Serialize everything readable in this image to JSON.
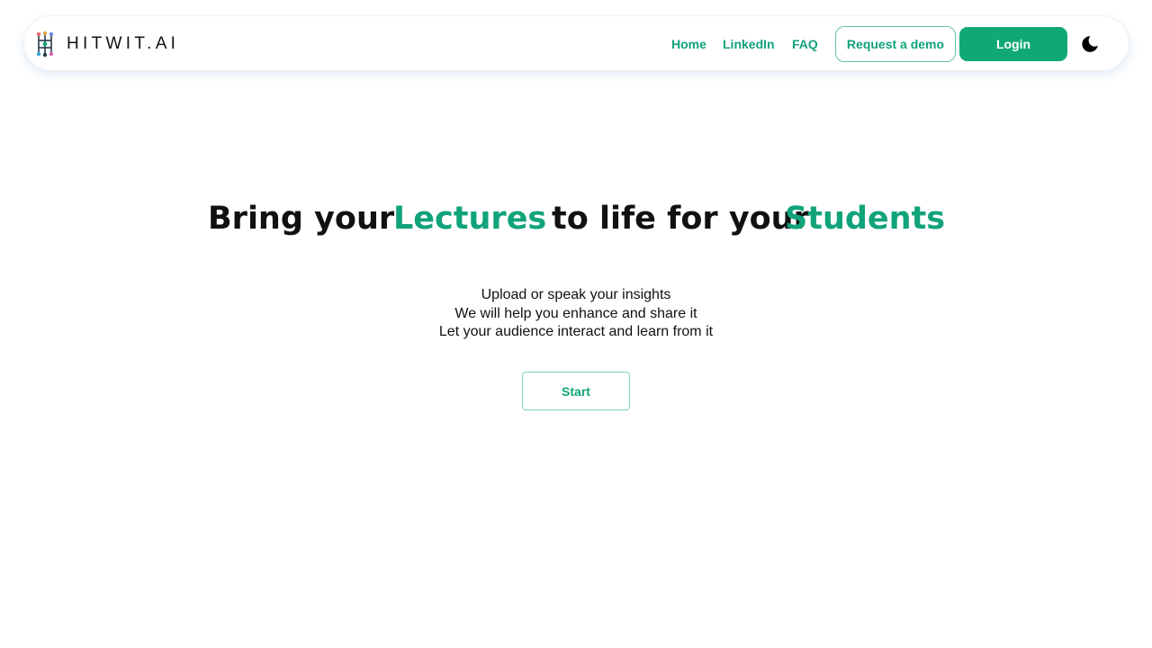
{
  "brand": {
    "name": "HITWIT.AI",
    "logo_icon": "circuit-logo-icon"
  },
  "nav": {
    "links": [
      "Home",
      "LinkedIn",
      "FAQ"
    ],
    "demo_label": "Request a demo",
    "login_label": "Login",
    "theme_icon": "moon-icon"
  },
  "hero": {
    "part1": "Bring your",
    "accent1": "Lectures",
    "part2": "to life for your",
    "accent2": "Students"
  },
  "sub": {
    "lines": [
      "Upload or speak your insights",
      "We will help you enhance and share it",
      "Let your audience interact and learn from it"
    ]
  },
  "cta": {
    "start_label": "Start"
  },
  "colors": {
    "accent": "#11a37a",
    "button": "#11a877",
    "text": "#111111"
  }
}
